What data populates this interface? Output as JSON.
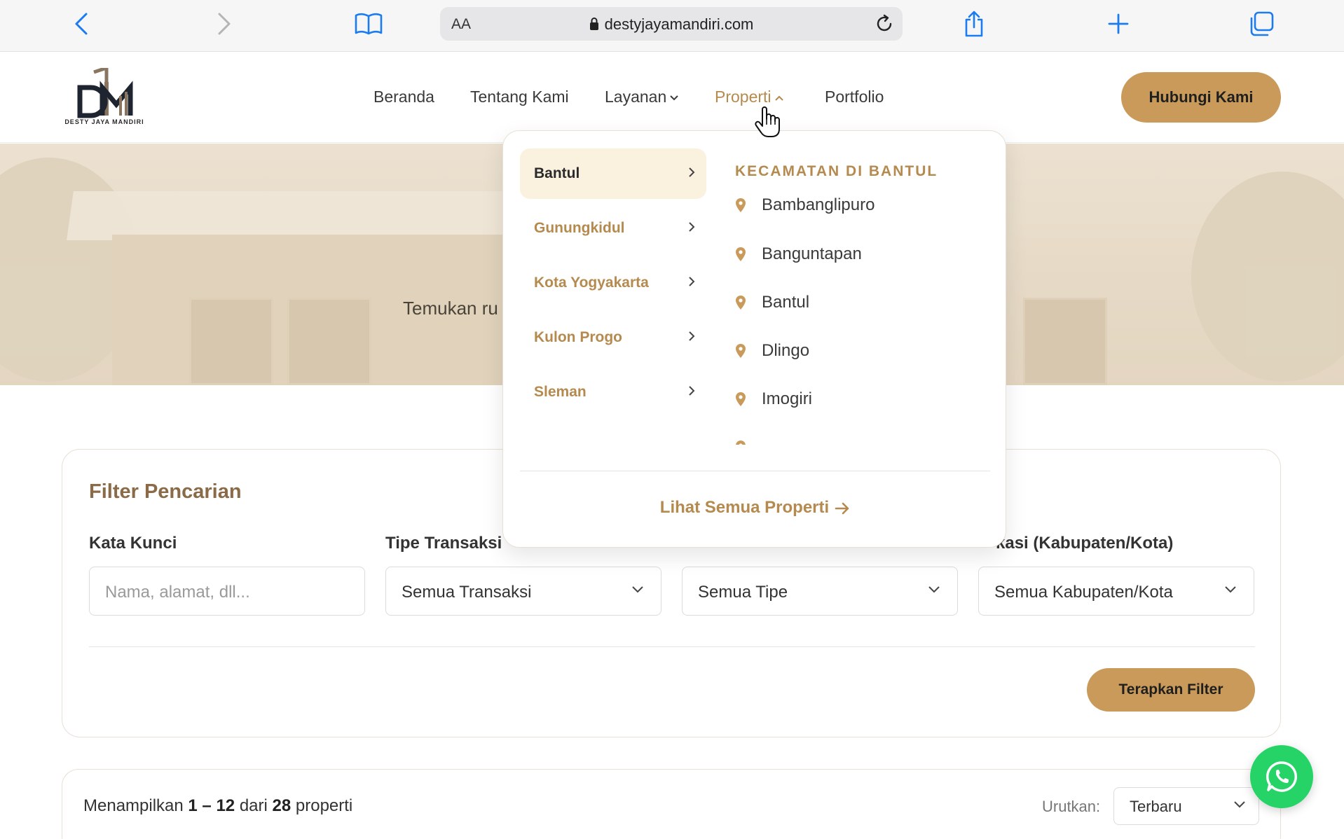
{
  "browser": {
    "aa_label": "AA",
    "url": "destyjayamandiri.com"
  },
  "site": {
    "logo_text": "DESTY JAYA MANDIRI",
    "nav": [
      {
        "label": "Beranda"
      },
      {
        "label": "Tentang Kami"
      },
      {
        "label": "Layanan"
      },
      {
        "label": "Properti"
      },
      {
        "label": "Portfolio"
      }
    ],
    "contact_button": "Hubungi Kami",
    "accent_color": "#c99a5a"
  },
  "hero": {
    "subtitle_visible": "Temukan ru"
  },
  "dropdown": {
    "regions": [
      {
        "label": "Bantul"
      },
      {
        "label": "Gunungkidul"
      },
      {
        "label": "Kota Yogyakarta"
      },
      {
        "label": "Kulon Progo"
      },
      {
        "label": "Sleman"
      }
    ],
    "active_region": "Bantul",
    "kecamatan_title": "KECAMATAN DI BANTUL",
    "kecamatan": [
      {
        "label": "Bambanglipuro"
      },
      {
        "label": "Banguntapan"
      },
      {
        "label": "Bantul"
      },
      {
        "label": "Dlingo"
      },
      {
        "label": "Imogiri"
      }
    ],
    "see_all": "Lihat Semua Properti"
  },
  "filter": {
    "title": "Filter Pencarian",
    "keyword_label": "Kata Kunci",
    "keyword_placeholder": "Nama, alamat, dll...",
    "transaction_label": "Tipe Transaksi",
    "transaction_value": "Semua Transaksi",
    "type_value": "Semua Tipe",
    "location_label_visible": "kasi (Kabupaten/Kota)",
    "location_value": "Semua Kabupaten/Kota",
    "apply_button": "Terapkan Filter"
  },
  "results": {
    "prefix": "Menampilkan",
    "range": "1 – 12",
    "of": "dari",
    "total": "28",
    "suffix": "properti",
    "sort_label": "Urutkan:",
    "sort_value": "Terbaru"
  }
}
